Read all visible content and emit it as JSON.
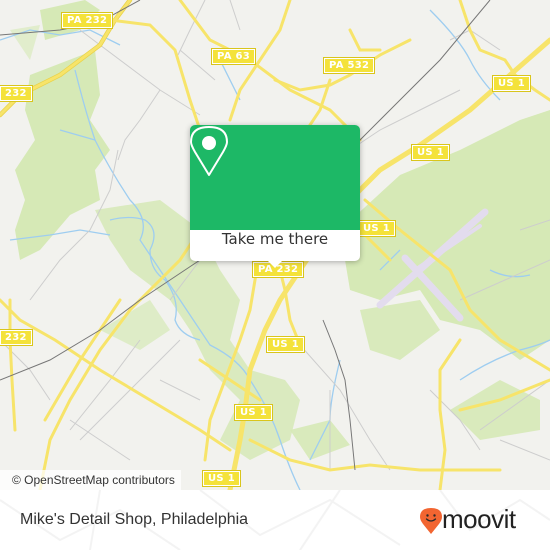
{
  "map": {
    "shields": [
      {
        "label": "PA 232",
        "id": "pa232-top"
      },
      {
        "label": "232",
        "id": "pa232-left-top"
      },
      {
        "label": "PA 63",
        "id": "pa63"
      },
      {
        "label": "PA 532",
        "id": "pa532"
      },
      {
        "label": "US 1",
        "id": "us1-northeast"
      },
      {
        "label": "US 1",
        "id": "us1-mid-upper"
      },
      {
        "label": "US 1",
        "id": "us1-right-of-popup"
      },
      {
        "label": "PA 232",
        "id": "pa232-under-popup"
      },
      {
        "label": "232",
        "id": "pa232-left-bottom"
      },
      {
        "label": "US 1",
        "id": "us1-center"
      },
      {
        "label": "US 1",
        "id": "us1-lower"
      },
      {
        "label": "US 1",
        "id": "us1-bottom"
      }
    ],
    "attribution": "© OpenStreetMap contributors",
    "colors": {
      "land": "#f2f2ee",
      "park": "#d4e8b4",
      "road_major": "#f7e46a",
      "road_minor": "#cfcfcf",
      "water": "#9ecdf0",
      "railway": "#777777",
      "airport_runway": "#e3dcee"
    }
  },
  "popup": {
    "icon": "map-pin-icon",
    "action_label": "Take me there",
    "accent_color": "#1db866"
  },
  "footer": {
    "place_name": "Mike's Detail Shop, Philadelphia",
    "brand": "moovit",
    "brand_icon": "moovit-smiley-pin-icon",
    "brand_color": "#f26531"
  }
}
